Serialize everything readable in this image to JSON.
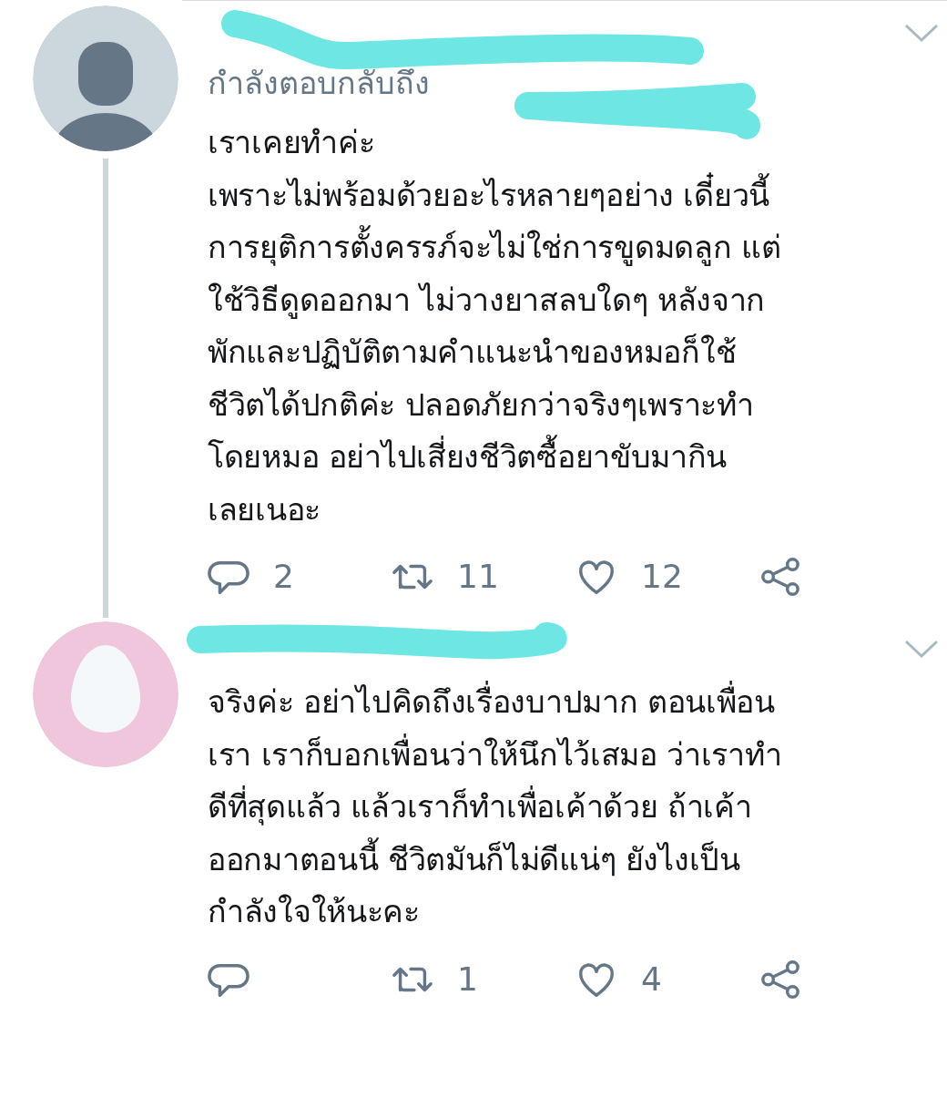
{
  "tweets": [
    {
      "kind": "silhouette",
      "reply_to": "กำลังตอบกลับถึง",
      "text": "เราเคยทำค่ะ\nเพราะไม่พร้อมด้วยอะไรหลายๆอย่าง เดี๋ยวนี้\nการยุติการตั้งครรภ์จะไม่ใช่การขูดมดลูก แต่\nใช้วิธีดูดออกมา ไม่วางยาสลบใดๆ หลังจาก\nพักและปฏิบัติตามคำแนะนำของหมอก็ใช้\nชีวิตได้ปกติค่ะ ปลอดภัยกว่าจริงๆเพราะทำ\nโดยหมอ อย่าไปเสี่ยงชีวิตซื้อยาขับมากิน\nเลยเนอะ",
      "replies": "2",
      "retweets": "11",
      "likes": "12",
      "thread_continues": true
    },
    {
      "kind": "egg",
      "text": "จริงค่ะ อย่าไปคิดถึงเรื่องบาปมาก ตอนเพื่อน\nเรา เราก็บอกเพื่อนว่าให้นึกไว้เสมอ ว่าเราทำ\nดีที่สุดแล้ว แล้วเราก็ทำเพื่อเค้าด้วย ถ้าเค้า\nออกมาตอนนี้ ชีวิตมันก็ไม่ดีแน่ๆ ยังไงเป็น\nกำลังใจให้นะคะ",
      "retweets": "1",
      "likes": "4",
      "thread_continues": false
    }
  ]
}
